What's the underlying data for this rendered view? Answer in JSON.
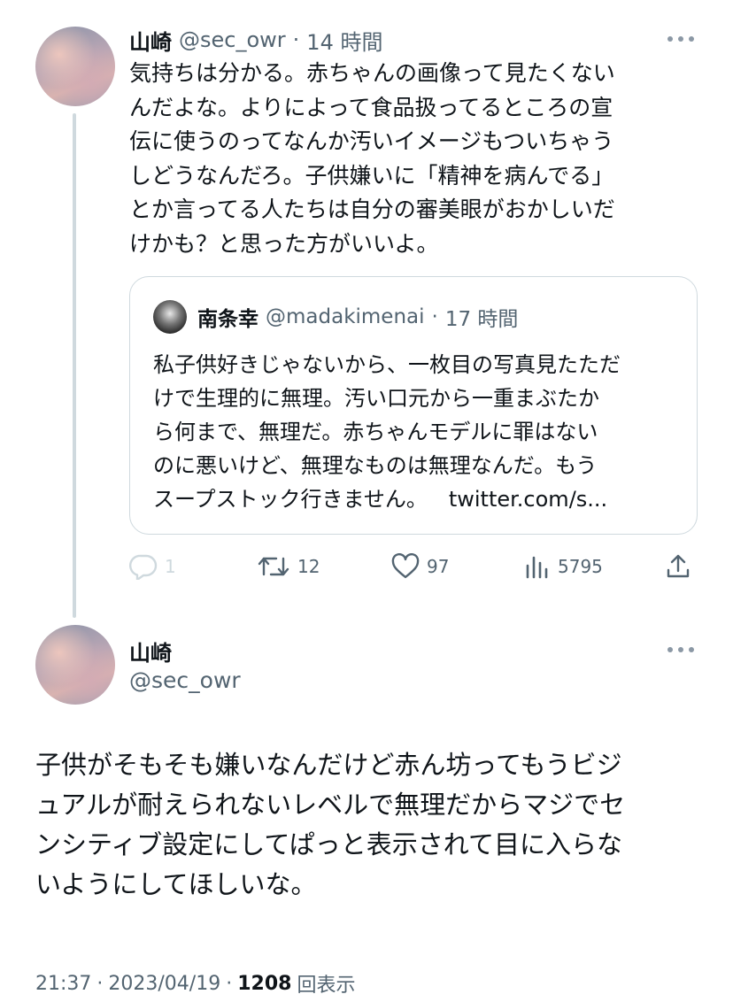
{
  "reply_tweet": {
    "author_name": "山崎",
    "handle": "@sec_owr",
    "time": "14 時間",
    "text": "気持ちは分かる。赤ちゃんの画像って見たくない\nんだよな。よりによって食品扱ってるところの宣\n伝に使うのってなんか汚いイメージもついちゃう\nしどうなんだろ。子供嫌いに「精神を病んでる」\nとか言ってる人たちは自分の審美眼がおかしいだ\nけかも？と思った方がいいよ。",
    "quote": {
      "author_name": "南条幸",
      "handle": "@madakimenai",
      "time": "17 時間",
      "text": "私子供好きじゃないから、一枚目の写真見たただ\nけで生理的に無理。汚い口元から一重まぶたか\nら何まで、無理だ。赤ちゃんモデルに罪はない\nのに悪いけど、無理なものは無理なんだ。もう\nスープストック行きません。",
      "link": "twitter.com/s..."
    },
    "actions": {
      "replies": "1",
      "retweets": "12",
      "likes": "97",
      "views": "5795"
    }
  },
  "main_tweet": {
    "author_name": "山崎",
    "handle": "@sec_owr",
    "text": "子供がそもそも嫌いなんだけど赤ん坊ってもうビジ\nュアルが耐えられないレベルで無理だからマジでセ\nンシティブ設定にしてぱっと表示されて目に入らな\nいようにしてほしいな。",
    "time": "21:37",
    "date": "2023/04/19",
    "views_count": "1208",
    "views_label": "回表示"
  },
  "separator": "·",
  "icons": {
    "more": "more-icon",
    "reply": "reply-icon",
    "retweet": "retweet-icon",
    "like": "heart-icon",
    "views": "views-icon",
    "share": "share-icon"
  }
}
